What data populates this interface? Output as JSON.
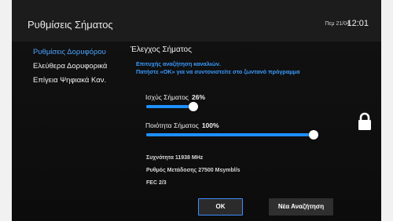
{
  "header": {
    "title": "Ρυθμίσεις Σήματος",
    "date": "Πεμ 21/04",
    "time": "12:01"
  },
  "sidebar": {
    "items": [
      {
        "label": "Ρυθμίσεις Δορυφόρου",
        "active": true
      },
      {
        "label": "Ελεύθερα Δορυφορικά",
        "active": false
      },
      {
        "label": "Επίγεια Ψηφιακά Καν.",
        "active": false
      }
    ]
  },
  "main": {
    "section_title": "Έλεγχος Σήματος",
    "message_line1": "Επιτυχής αναζήτηση καναλιών.",
    "message_line2": "Πατήστε «ΟΚ» για να συντονιστείτε στο ζωντανό πρόγραμμα",
    "strength": {
      "label": "Ισχύς Σήματος",
      "value_text": "26%",
      "level": 0.26
    },
    "quality": {
      "label": "Ποιότητα Σήματος",
      "value_text": "100%",
      "level": 1.0
    },
    "frequency": "Συχνότητα 11938 MHz",
    "symbol_rate": "Ρυθμός Μετάδοσης 27500 Msymbl/s",
    "fec": "FEC 2/3"
  },
  "buttons": {
    "ok_label": "OK",
    "new_search_label": "Νέα Αναζήτηση"
  },
  "icons": {
    "lock": "lock-icon"
  },
  "colors": {
    "accent": "#1e90ff",
    "message": "#3a9bff",
    "background": "#0e0e0e"
  }
}
